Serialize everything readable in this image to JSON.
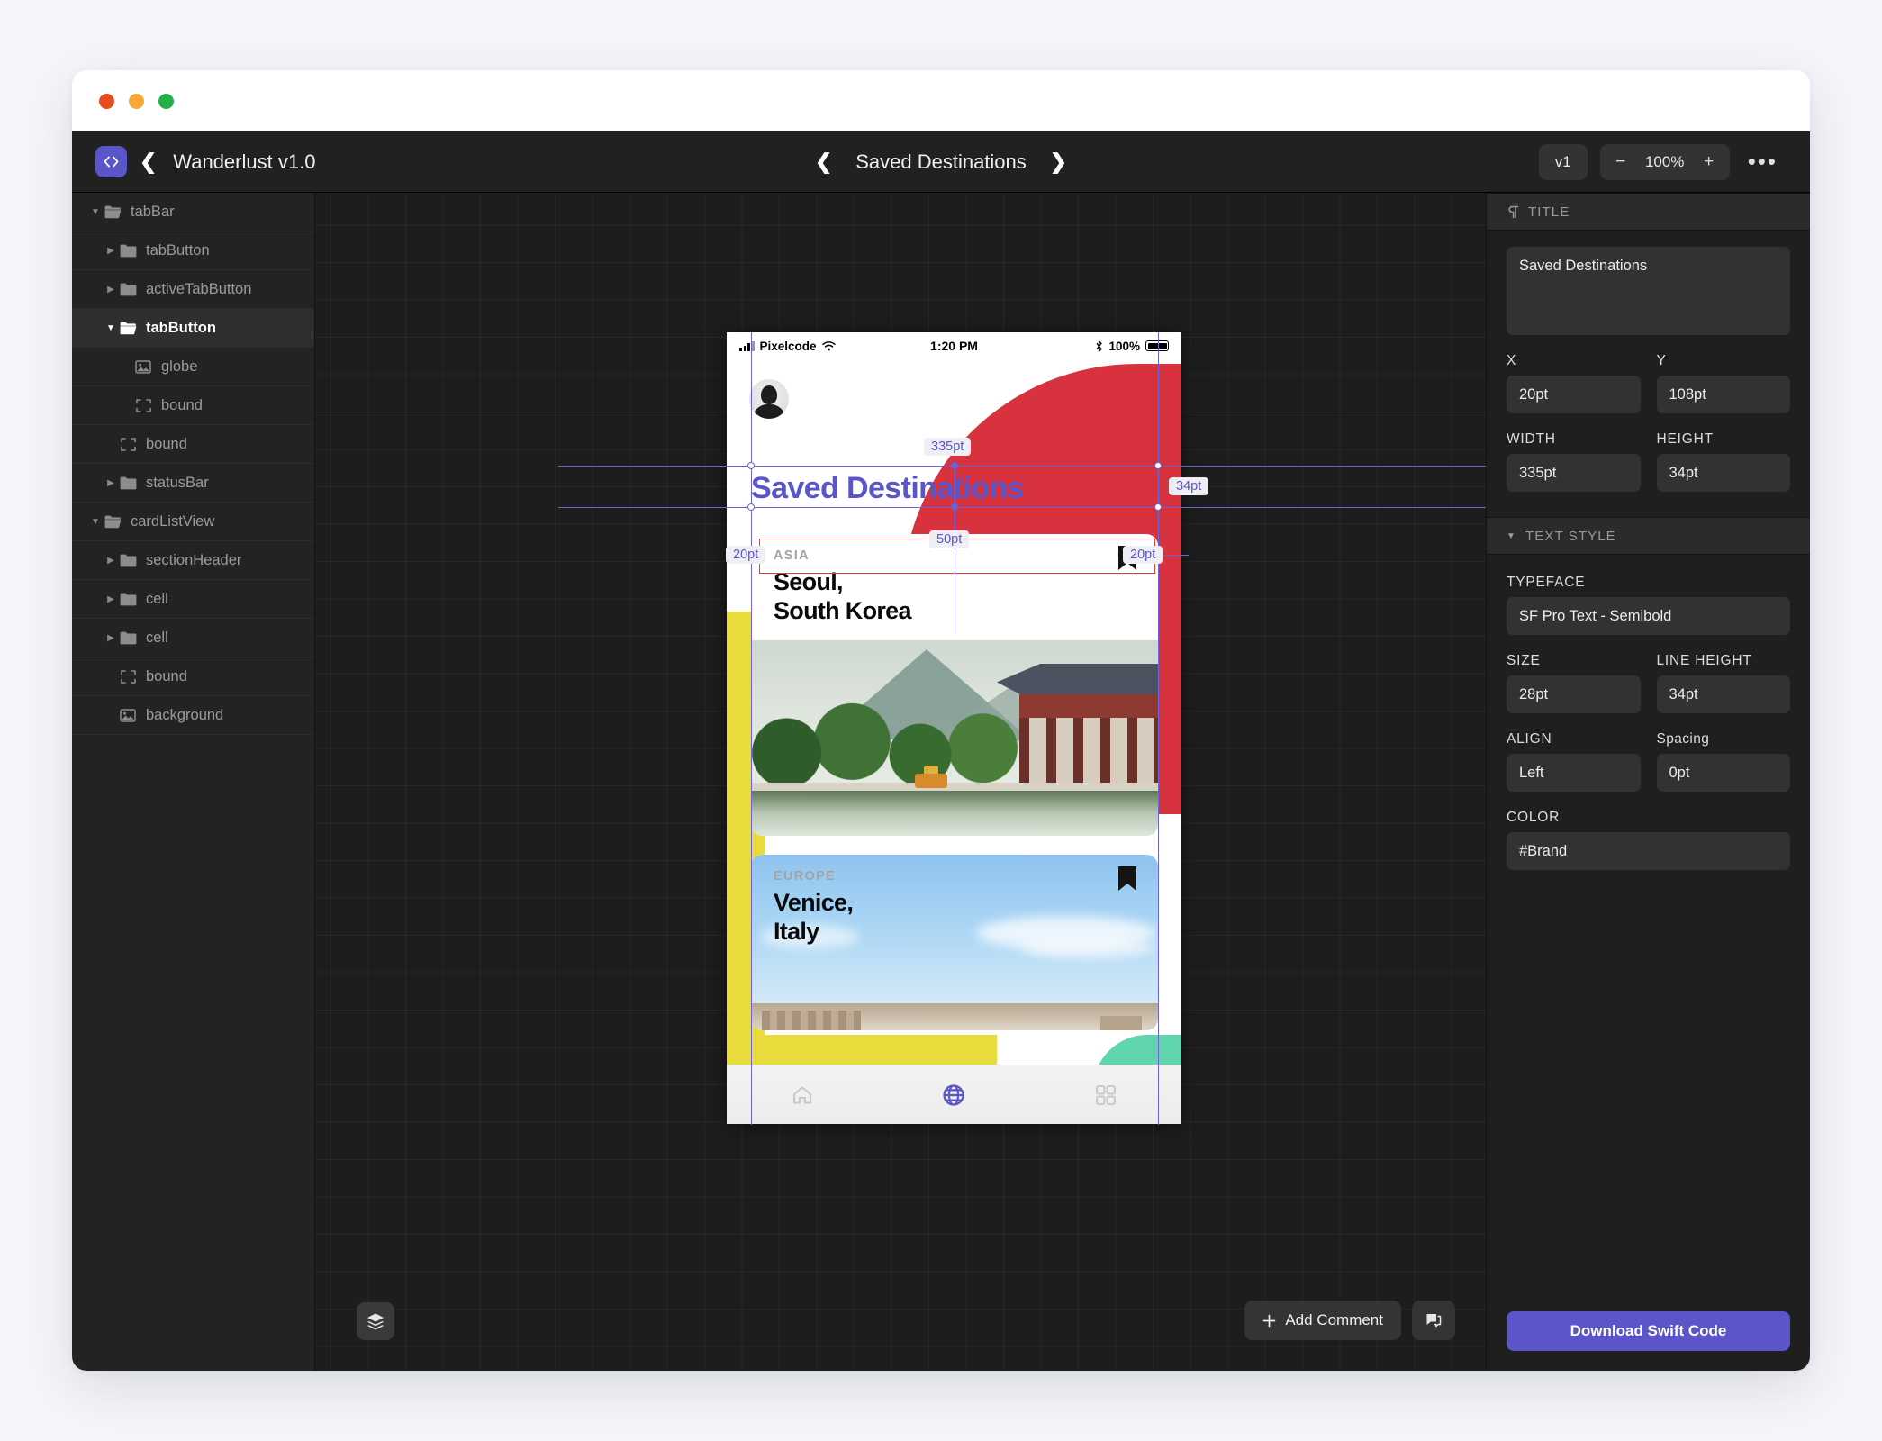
{
  "window": {
    "traffic_lights": [
      "close",
      "minimize",
      "zoom"
    ]
  },
  "toolbar": {
    "logo": "code-brackets-icon",
    "back_icon": "chevron-left-icon",
    "project_name": "Wanderlust v1.0",
    "screen_prev_icon": "chevron-left-icon",
    "screen_name": "Saved Destinations",
    "screen_next_icon": "chevron-right-icon",
    "version_label": "v1",
    "zoom_out_label": "−",
    "zoom_value": "100%",
    "zoom_in_label": "+",
    "more_label": "•••"
  },
  "layers": {
    "items": [
      {
        "label": "tabBar",
        "depth": 0,
        "twisty": "down",
        "icon": "folder-open-icon",
        "selected": false
      },
      {
        "label": "tabButton",
        "depth": 1,
        "twisty": "right",
        "icon": "folder-icon",
        "selected": false
      },
      {
        "label": "activeTabButton",
        "depth": 1,
        "twisty": "right",
        "icon": "folder-icon",
        "selected": false
      },
      {
        "label": "tabButton",
        "depth": 1,
        "twisty": "down",
        "icon": "folder-open-icon",
        "selected": true
      },
      {
        "label": "globe",
        "depth": 2,
        "twisty": "none",
        "icon": "image-icon",
        "selected": false
      },
      {
        "label": "bound",
        "depth": 2,
        "twisty": "none",
        "icon": "bound-icon",
        "selected": false
      },
      {
        "label": "bound",
        "depth": 1,
        "twisty": "none",
        "icon": "bound-icon",
        "selected": false
      },
      {
        "label": "statusBar",
        "depth": 1,
        "twisty": "right",
        "icon": "folder-icon",
        "selected": false
      },
      {
        "label": "cardListView",
        "depth": 0,
        "twisty": "down",
        "icon": "folder-open-icon",
        "selected": false
      },
      {
        "label": "sectionHeader",
        "depth": 1,
        "twisty": "right",
        "icon": "folder-icon",
        "selected": false
      },
      {
        "label": "cell",
        "depth": 1,
        "twisty": "right",
        "icon": "folder-icon",
        "selected": false
      },
      {
        "label": "cell",
        "depth": 1,
        "twisty": "right",
        "icon": "folder-icon",
        "selected": false
      },
      {
        "label": "bound",
        "depth": 1,
        "twisty": "none",
        "icon": "bound-icon",
        "selected": false
      },
      {
        "label": "background",
        "depth": 1,
        "twisty": "none",
        "icon": "image-icon",
        "selected": false
      }
    ]
  },
  "canvas": {
    "layers_fab_icon": "layers-icon",
    "add_comment_icon": "plus-icon",
    "add_comment_label": "Add Comment",
    "comment_list_icon": "comment-icon",
    "measurements": [
      {
        "id": "width-badge",
        "label": "335pt"
      },
      {
        "id": "height-badge",
        "label": "34pt"
      },
      {
        "id": "spacing-badge",
        "label": "50pt"
      },
      {
        "id": "left-badge",
        "label": "20pt"
      },
      {
        "id": "right-badge",
        "label": "20pt"
      }
    ],
    "phone": {
      "status_bar": {
        "signal_icon": "signal-bars-icon",
        "carrier": "Pixelcode",
        "wifi_icon": "wifi-icon",
        "time": "1:20 PM",
        "bluetooth_icon": "bluetooth-icon",
        "battery_percent": "100%",
        "battery_icon": "battery-full-icon"
      },
      "avatar": "user-avatar",
      "title": "Saved Destinations",
      "cards": [
        {
          "kicker": "ASIA",
          "title_line1": "Seoul,",
          "title_line2": "South Korea",
          "bookmark_icon": "bookmark-icon",
          "photo": "gyeongbokgung-palace-photo"
        },
        {
          "kicker": "EUROPE",
          "title_line1": "Venice,",
          "title_line2": "Italy",
          "bookmark_icon": "bookmark-icon",
          "photo": "venice-skyline-photo"
        }
      ],
      "tabbar": [
        {
          "icon": "home-icon",
          "active": false
        },
        {
          "icon": "globe-icon",
          "active": true
        },
        {
          "icon": "grid-icon",
          "active": false
        }
      ]
    }
  },
  "inspector": {
    "title_section": {
      "icon": "paragraph-icon",
      "header": "TITLE",
      "text_value": "Saved Destinations",
      "fields": [
        {
          "label": "X",
          "value": "20pt"
        },
        {
          "label": "Y",
          "value": "108pt"
        },
        {
          "label": "WIDTH",
          "value": "335pt"
        },
        {
          "label": "HEIGHT",
          "value": "34pt"
        }
      ]
    },
    "text_style_section": {
      "twisty": "chevron-down-icon",
      "header": "TEXT STYLE",
      "typeface_label": "TYPEFACE",
      "typeface_value": "SF Pro Text - Semibold",
      "fields": [
        {
          "label": "SIZE",
          "value": "28pt"
        },
        {
          "label": "LINE HEIGHT",
          "value": "34pt"
        },
        {
          "label": "ALIGN",
          "value": "Left"
        },
        {
          "label": "Spacing",
          "value": "0pt"
        }
      ],
      "color_label": "COLOR",
      "color_value": "#Brand"
    },
    "download_button": "Download Swift Code"
  },
  "colors": {
    "brand": "#5a55c8",
    "guide": "#6b63d6",
    "guide_red": "#e23b3b",
    "panel": "#1f1f1f",
    "canvas": "#1d1d1d"
  }
}
